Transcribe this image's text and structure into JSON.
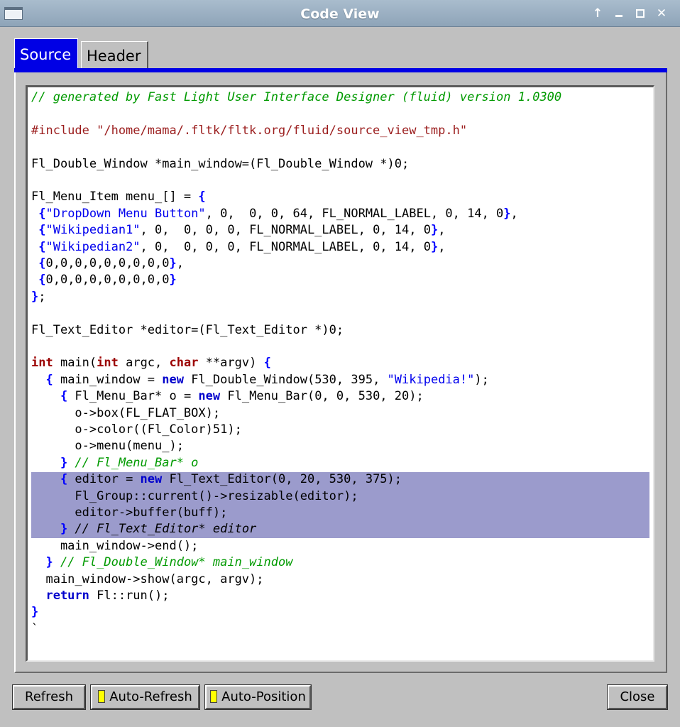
{
  "window": {
    "title": "Code View"
  },
  "tabs": [
    {
      "label": "Source",
      "active": true
    },
    {
      "label": "Header",
      "active": false
    }
  ],
  "buttons": {
    "refresh": "Refresh",
    "auto_refresh": "Auto-Refresh",
    "auto_position": "Auto-Position",
    "close": "Close"
  },
  "colors": {
    "tab_active": "#0000e5",
    "selection": "#9b9bcc",
    "comment": "#009a00",
    "keyword": "#9b0000",
    "string": "#0000ee",
    "indicator": "#ffff00"
  },
  "code_lines": [
    [
      [
        "cm",
        "// generated by Fast Light User Interface Designer (fluid) version 1.0300"
      ]
    ],
    [],
    [
      [
        "pp",
        "#include \"/home/mama/.fltk/fltk.org/fluid/source_view_tmp.h\""
      ]
    ],
    [],
    [
      [
        "",
        "Fl_Double_Window *main_window=(Fl_Double_Window *)0;"
      ]
    ],
    [],
    [
      [
        "",
        "Fl_Menu_Item menu_[] = "
      ],
      [
        "br",
        "{"
      ]
    ],
    [
      [
        "",
        ""
      ],
      [
        "br",
        " {"
      ],
      [
        "st",
        "\"DropDown Menu Button\""
      ],
      [
        "",
        ", 0,  0, 0, 64, FL_NORMAL_LABEL, 0, 14, 0"
      ],
      [
        "br",
        "}"
      ],
      [
        "",
        ","
      ]
    ],
    [
      [
        "br",
        " {"
      ],
      [
        "st",
        "\"Wikipedian1\""
      ],
      [
        "",
        ", 0,  0, 0, 0, FL_NORMAL_LABEL, 0, 14, 0"
      ],
      [
        "br",
        "}"
      ],
      [
        "",
        ","
      ]
    ],
    [
      [
        "br",
        " {"
      ],
      [
        "st",
        "\"Wikipedian2\""
      ],
      [
        "",
        ", 0,  0, 0, 0, FL_NORMAL_LABEL, 0, 14, 0"
      ],
      [
        "br",
        "}"
      ],
      [
        "",
        ","
      ]
    ],
    [
      [
        "br",
        " {"
      ],
      [
        "",
        "0,0,0,0,0,0,0,0,0"
      ],
      [
        "br",
        "}"
      ],
      [
        "",
        ","
      ]
    ],
    [
      [
        "br",
        " {"
      ],
      [
        "",
        "0,0,0,0,0,0,0,0,0"
      ],
      [
        "br",
        "}"
      ]
    ],
    [
      [
        "br",
        "}"
      ],
      [
        "",
        ";"
      ]
    ],
    [],
    [
      [
        "",
        "Fl_Text_Editor *editor=(Fl_Text_Editor *)0;"
      ]
    ],
    [],
    [
      [
        "kw",
        "int"
      ],
      [
        "",
        " main("
      ],
      [
        "kw",
        "int"
      ],
      [
        "",
        " argc, "
      ],
      [
        "kw",
        "char"
      ],
      [
        "",
        " **argv) "
      ],
      [
        "br",
        "{"
      ]
    ],
    [
      [
        "br",
        "  {"
      ],
      [
        "",
        " main_window = "
      ],
      [
        "nw",
        "new"
      ],
      [
        "",
        " Fl_Double_Window(530, 395, "
      ],
      [
        "st",
        "\"Wikipedia!\""
      ],
      [
        "",
        ");"
      ]
    ],
    [
      [
        "br",
        "    {"
      ],
      [
        "",
        " Fl_Menu_Bar* o = "
      ],
      [
        "nw",
        "new"
      ],
      [
        "",
        " Fl_Menu_Bar(0, 0, 530, 20);"
      ]
    ],
    [
      [
        "",
        "      o->box(FL_FLAT_BOX);"
      ]
    ],
    [
      [
        "",
        "      o->color((Fl_Color)51);"
      ]
    ],
    [
      [
        "",
        "      o->menu(menu_);"
      ]
    ],
    [
      [
        "br",
        "    }"
      ],
      [
        "cm",
        " // Fl_Menu_Bar* o"
      ]
    ],
    [
      [
        "br",
        "    {"
      ],
      [
        "",
        " editor = "
      ],
      [
        "nw",
        "new"
      ],
      [
        "",
        " Fl_Text_Editor(0, 20, 530, 375);"
      ]
    ],
    [
      [
        "",
        "      Fl_Group::current()->resizable(editor);"
      ]
    ],
    [
      [
        "",
        "      editor->buffer(buff);"
      ]
    ],
    [
      [
        "br",
        "    }"
      ],
      [
        "scm",
        " // Fl_Text_Editor* editor"
      ]
    ],
    [
      [
        "",
        "    main_window->end();"
      ]
    ],
    [
      [
        "br",
        "  }"
      ],
      [
        "cm",
        " // Fl_Double_Window* main_window"
      ]
    ],
    [
      [
        "",
        "  main_window->show(argc, argv);"
      ]
    ],
    [
      [
        "nw",
        "  return"
      ],
      [
        "",
        " Fl::run();"
      ]
    ],
    [
      [
        "br",
        "}"
      ]
    ],
    [
      [
        "",
        "`"
      ]
    ]
  ]
}
